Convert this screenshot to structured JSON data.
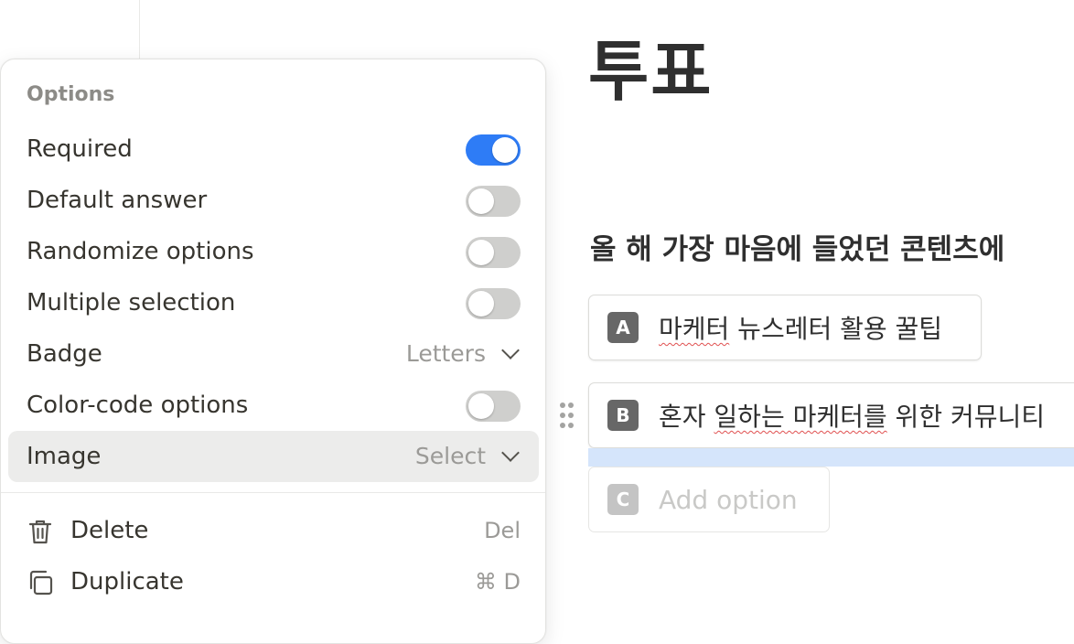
{
  "form": {
    "title": "투표",
    "question": "올 해 가장 마음에 들었던 콘텐츠에",
    "options": [
      {
        "badge": "A",
        "text_pre": "",
        "text_squiggle": "마케터",
        "text_post": " 뉴스레터 활용 꿀팁"
      },
      {
        "badge": "B",
        "text_pre": "혼자 ",
        "text_squiggle": "일하는 마케터를",
        "text_post": " 위한 커뮤니티"
      }
    ],
    "add_option": {
      "badge": "C",
      "placeholder": "Add option"
    }
  },
  "panel": {
    "heading": "Options",
    "toggles": {
      "required": {
        "label": "Required",
        "on": true
      },
      "default_answer": {
        "label": "Default answer",
        "on": false
      },
      "randomize": {
        "label": "Randomize options",
        "on": false
      },
      "multiple": {
        "label": "Multiple selection",
        "on": false
      },
      "color_code": {
        "label": "Color-code options",
        "on": false
      }
    },
    "badge": {
      "label": "Badge",
      "value": "Letters"
    },
    "image": {
      "label": "Image",
      "value": "Select"
    },
    "delete": {
      "label": "Delete",
      "shortcut": "Del"
    },
    "duplicate": {
      "label": "Duplicate",
      "shortcut": "⌘ D"
    }
  },
  "colors": {
    "accent": "#2e7cf6",
    "selection": "#d5e5fb",
    "spellcheck": "#e05050"
  },
  "icons": {
    "delete": "trash-icon",
    "duplicate": "copy-icon",
    "drag": "drag-handle-icon",
    "dropdown": "chevron-down-icon"
  }
}
